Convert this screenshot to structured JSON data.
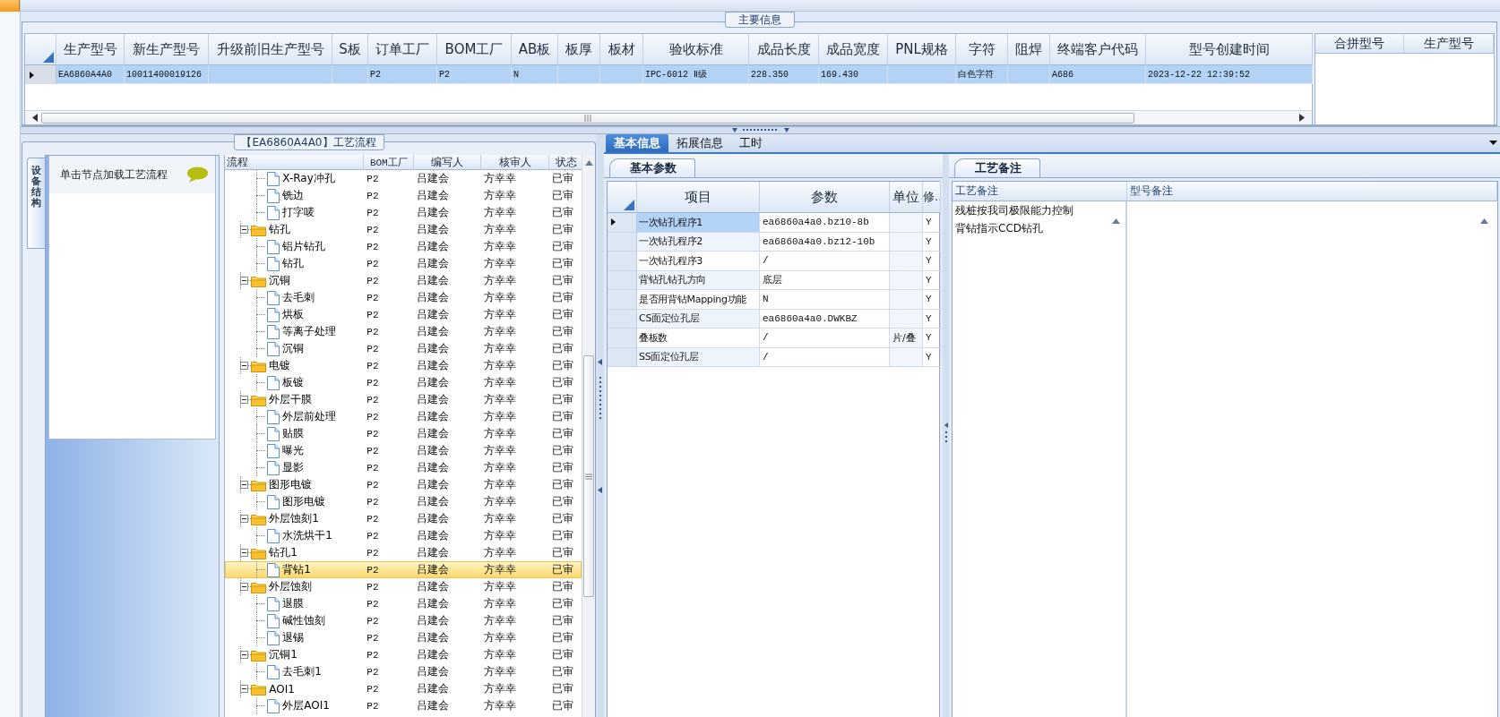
{
  "main_info": {
    "title": "主要信息",
    "columns": [
      "生产型号",
      "新生产型号",
      "升级前旧生产型号",
      "S板",
      "订单工厂",
      "BOM工厂",
      "AB板",
      "板厚",
      "板材",
      "验收标准",
      "成品长度",
      "成品宽度",
      "PNL规格",
      "字符",
      "阻焊",
      "终端客户代码",
      "型号创建时间"
    ],
    "rows": [
      {
        "selected": true,
        "cells": [
          "EA6860A4A0",
          "10011400019126",
          null,
          null,
          "P2",
          "P2",
          "N",
          null,
          null,
          "IPC-6012 Ⅱ级",
          "228.350",
          "169.430",
          null,
          "白色字符",
          null,
          "A686",
          "2023-12-22 12:39:52"
        ]
      }
    ],
    "merge_columns": [
      "合拼型号",
      "生产型号"
    ]
  },
  "flow": {
    "title": "【EA6860A4A0】工艺流程",
    "side_tab": "设备结构",
    "hint": "单击节点加载工艺流程",
    "columns": [
      "流程",
      "BOM工厂",
      "编写人",
      "核审人",
      "状态"
    ],
    "nodes": [
      {
        "kind": "step",
        "label": "X-Ray冲孔",
        "bom": "P2",
        "author": "吕建会",
        "reviewer": "方幸幸",
        "status": "已审",
        "selected": false
      },
      {
        "kind": "step",
        "label": "铣边",
        "bom": "P2",
        "author": "吕建会",
        "reviewer": "方幸幸",
        "status": "已审",
        "selected": false
      },
      {
        "kind": "step",
        "label": "打字唛",
        "bom": "P2",
        "author": "吕建会",
        "reviewer": "方幸幸",
        "status": "已审",
        "selected": false
      },
      {
        "kind": "group",
        "label": "钻孔",
        "bom": "P2",
        "author": "吕建会",
        "reviewer": "方幸幸",
        "status": "已审",
        "selected": false,
        "expanded": true,
        "children": [
          {
            "kind": "step",
            "label": "铝片钻孔",
            "bom": "P2",
            "author": "吕建会",
            "reviewer": "方幸幸",
            "status": "已审",
            "selected": false
          },
          {
            "kind": "step",
            "label": "钻孔",
            "bom": "P2",
            "author": "吕建会",
            "reviewer": "方幸幸",
            "status": "已审",
            "selected": false
          }
        ]
      },
      {
        "kind": "group",
        "label": "沉铜",
        "bom": "P2",
        "author": "吕建会",
        "reviewer": "方幸幸",
        "status": "已审",
        "selected": false,
        "expanded": true,
        "children": [
          {
            "kind": "step",
            "label": "去毛刺",
            "bom": "P2",
            "author": "吕建会",
            "reviewer": "方幸幸",
            "status": "已审",
            "selected": false
          },
          {
            "kind": "step",
            "label": "烘板",
            "bom": "P2",
            "author": "吕建会",
            "reviewer": "方幸幸",
            "status": "已审",
            "selected": false
          },
          {
            "kind": "step",
            "label": "等离子处理",
            "bom": "P2",
            "author": "吕建会",
            "reviewer": "方幸幸",
            "status": "已审",
            "selected": false
          },
          {
            "kind": "step",
            "label": "沉铜",
            "bom": "P2",
            "author": "吕建会",
            "reviewer": "方幸幸",
            "status": "已审",
            "selected": false
          }
        ]
      },
      {
        "kind": "group",
        "label": "电镀",
        "bom": "P2",
        "author": "吕建会",
        "reviewer": "方幸幸",
        "status": "已审",
        "selected": false,
        "expanded": true,
        "children": [
          {
            "kind": "step",
            "label": "板镀",
            "bom": "P2",
            "author": "吕建会",
            "reviewer": "方幸幸",
            "status": "已审",
            "selected": false
          }
        ]
      },
      {
        "kind": "group",
        "label": "外层干膜",
        "bom": "P2",
        "author": "吕建会",
        "reviewer": "方幸幸",
        "status": "已审",
        "selected": false,
        "expanded": true,
        "children": [
          {
            "kind": "step",
            "label": "外层前处理",
            "bom": "P2",
            "author": "吕建会",
            "reviewer": "方幸幸",
            "status": "已审",
            "selected": false
          },
          {
            "kind": "step",
            "label": "贴膜",
            "bom": "P2",
            "author": "吕建会",
            "reviewer": "方幸幸",
            "status": "已审",
            "selected": false
          },
          {
            "kind": "step",
            "label": "曝光",
            "bom": "P2",
            "author": "吕建会",
            "reviewer": "方幸幸",
            "status": "已审",
            "selected": false
          },
          {
            "kind": "step",
            "label": "显影",
            "bom": "P2",
            "author": "吕建会",
            "reviewer": "方幸幸",
            "status": "已审",
            "selected": false
          }
        ]
      },
      {
        "kind": "group",
        "label": "图形电镀",
        "bom": "P2",
        "author": "吕建会",
        "reviewer": "方幸幸",
        "status": "已审",
        "selected": false,
        "expanded": true,
        "children": [
          {
            "kind": "step",
            "label": "图形电镀",
            "bom": "P2",
            "author": "吕建会",
            "reviewer": "方幸幸",
            "status": "已审",
            "selected": false
          }
        ]
      },
      {
        "kind": "group",
        "label": "外层蚀刻1",
        "bom": "P2",
        "author": "吕建会",
        "reviewer": "方幸幸",
        "status": "已审",
        "selected": false,
        "expanded": true,
        "children": [
          {
            "kind": "step",
            "label": "水洗烘干1",
            "bom": "P2",
            "author": "吕建会",
            "reviewer": "方幸幸",
            "status": "已审",
            "selected": false
          }
        ]
      },
      {
        "kind": "group",
        "label": "钻孔1",
        "bom": "P2",
        "author": "吕建会",
        "reviewer": "方幸幸",
        "status": "已审",
        "selected": false,
        "expanded": true,
        "children": [
          {
            "kind": "step",
            "label": "背钻1",
            "bom": "P2",
            "author": "吕建会",
            "reviewer": "方幸幸",
            "status": "已审",
            "selected": true
          }
        ]
      },
      {
        "kind": "group",
        "label": "外层蚀刻",
        "bom": "P2",
        "author": "吕建会",
        "reviewer": "方幸幸",
        "status": "已审",
        "selected": false,
        "expanded": true,
        "children": [
          {
            "kind": "step",
            "label": "退膜",
            "bom": "P2",
            "author": "吕建会",
            "reviewer": "方幸幸",
            "status": "已审",
            "selected": false
          },
          {
            "kind": "step",
            "label": "碱性蚀刻",
            "bom": "P2",
            "author": "吕建会",
            "reviewer": "方幸幸",
            "status": "已审",
            "selected": false
          },
          {
            "kind": "step",
            "label": "退锡",
            "bom": "P2",
            "author": "吕建会",
            "reviewer": "方幸幸",
            "status": "已审",
            "selected": false
          }
        ]
      },
      {
        "kind": "group",
        "label": "沉铜1",
        "bom": "P2",
        "author": "吕建会",
        "reviewer": "方幸幸",
        "status": "已审",
        "selected": false,
        "expanded": true,
        "children": [
          {
            "kind": "step",
            "label": "去毛刺1",
            "bom": "P2",
            "author": "吕建会",
            "reviewer": "方幸幸",
            "status": "已审",
            "selected": false
          }
        ]
      },
      {
        "kind": "group",
        "label": "AOI1",
        "bom": "P2",
        "author": "吕建会",
        "reviewer": "方幸幸",
        "status": "已审",
        "selected": false,
        "expanded": true,
        "children": [
          {
            "kind": "step",
            "label": "外层AOI1",
            "bom": "P2",
            "author": "吕建会",
            "reviewer": "方幸幸",
            "status": "已审",
            "selected": false
          }
        ]
      }
    ]
  },
  "detail": {
    "tabs": [
      {
        "label": "基本信息",
        "selected": true
      },
      {
        "label": "拓展信息",
        "selected": false
      },
      {
        "label": "工时",
        "selected": false
      }
    ],
    "params": {
      "tab": "基本参数",
      "columns": [
        "项目",
        "参数",
        "单位",
        "修.."
      ],
      "rows": [
        {
          "item": "一次钻孔程序1",
          "value": "ea6860a4a0.bz10-8b",
          "unit": null,
          "flag": "Y",
          "selected": true
        },
        {
          "item": "一次钻孔程序2",
          "value": "ea6860a4a0.bz12-10b",
          "unit": null,
          "flag": "Y",
          "selected": false
        },
        {
          "item": "一次钻孔程序3",
          "value": "/",
          "unit": null,
          "flag": "Y",
          "selected": false
        },
        {
          "item": "背钻孔钻孔方向",
          "value": "底层",
          "unit": null,
          "flag": "Y",
          "selected": false
        },
        {
          "item": "是否用背钻Mapping功能",
          "value": "N",
          "unit": null,
          "flag": "Y",
          "selected": false
        },
        {
          "item": "CS面定位孔层",
          "value": "ea6860a4a0.DWKBZ",
          "unit": null,
          "flag": "Y",
          "selected": false
        },
        {
          "item": "叠板数",
          "value": "/",
          "unit": "片/叠",
          "flag": "Y",
          "selected": false
        },
        {
          "item": "SS面定位孔层",
          "value": "/",
          "unit": null,
          "flag": "Y",
          "selected": false
        }
      ]
    },
    "notes": {
      "tab": "工艺备注",
      "columns": [
        "工艺备注",
        "型号备注"
      ],
      "process_notes": [
        "残桩按我司极限能力控制",
        "背钻指示CCD钻孔"
      ]
    }
  }
}
